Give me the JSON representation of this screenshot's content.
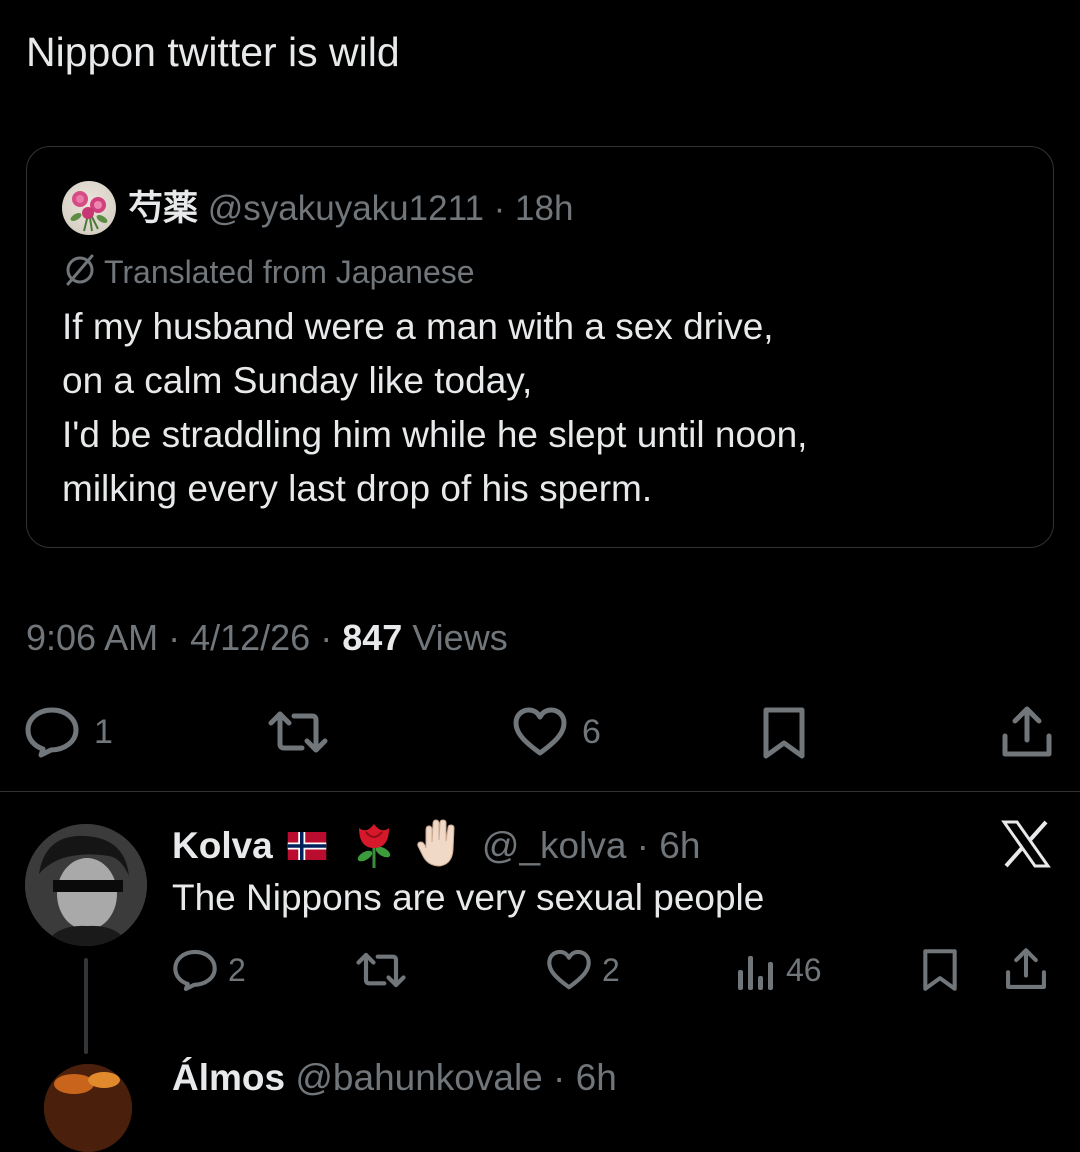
{
  "post": {
    "text": "Nippon twitter is wild"
  },
  "quoted": {
    "display_name": "芍薬",
    "handle": "@syakuyaku1211",
    "time": "18h",
    "translated_label": "Translated from Japanese",
    "lines": [
      "If my husband were a man with a sex drive,",
      "on a calm Sunday like today,",
      "I'd be straddling him while he slept until noon,",
      "milking every last drop of his sperm."
    ]
  },
  "meta": {
    "time": "9:06 AM",
    "date": "4/12/26",
    "views_count": "847",
    "views_label": "Views"
  },
  "actions": {
    "replies": "1",
    "likes": "6"
  },
  "reply": {
    "display_name": "Kolva",
    "handle": "@_kolva",
    "time": "6h",
    "text": "The Nippons are very sexual people",
    "replies": "2",
    "likes": "2",
    "views": "46"
  },
  "next_reply": {
    "display_name": "Álmos",
    "handle": "@bahunkovale",
    "time": "6h"
  },
  "colors": {
    "background": "#000000",
    "text": "#e7e9ea",
    "muted": "#71767b",
    "border": "#2f3336"
  },
  "icons": {
    "reply": "speech-bubble-icon",
    "repost": "repost-arrows-icon",
    "like": "heart-icon",
    "bookmark": "bookmark-icon",
    "share": "share-upload-icon",
    "views": "bar-chart-icon",
    "translate": "globe-slash-icon",
    "platform": "x-logo-icon",
    "flag": "norway-flag-icon",
    "rose": "rose-emoji-icon",
    "hand": "raised-hand-emoji-icon"
  }
}
